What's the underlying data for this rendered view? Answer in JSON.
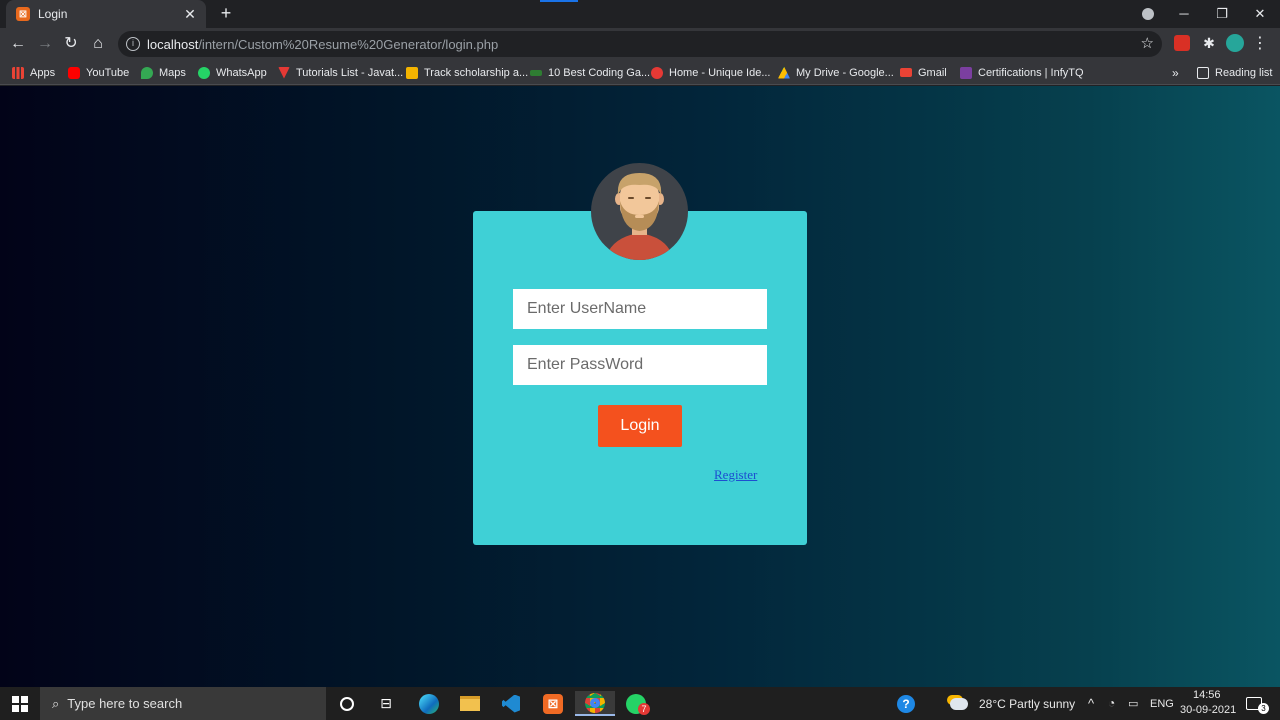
{
  "browser": {
    "tab_title": "Login",
    "tab_favicon": "xampp-icon",
    "url_host": "localhost",
    "url_path": "/intern/Custom%20Resume%20Generator/login.php",
    "bookmarks": [
      {
        "label": "Apps",
        "icon": "apps-grid-icon",
        "color": "#4285f4"
      },
      {
        "label": "YouTube",
        "icon": "youtube-icon",
        "color": "#ff0000"
      },
      {
        "label": "Maps",
        "icon": "maps-icon",
        "color": "#34a853"
      },
      {
        "label": "WhatsApp",
        "icon": "whatsapp-icon",
        "color": "#25d366"
      },
      {
        "label": "Tutorials List - Javat...",
        "icon": "javatpoint-icon",
        "color": "#e53935"
      },
      {
        "label": "Track scholarship a...",
        "icon": "scholarship-icon",
        "color": "#f4b400"
      },
      {
        "label": "10 Best Coding Ga...",
        "icon": "coding-games-icon",
        "color": "#2e7d32"
      },
      {
        "label": "Home - Unique Ide...",
        "icon": "rss-icon",
        "color": "#e53935"
      },
      {
        "label": "My Drive - Google...",
        "icon": "google-drive-icon",
        "color": "#fbbc04"
      },
      {
        "label": "Gmail",
        "icon": "gmail-icon",
        "color": "#ea4335"
      },
      {
        "label": "Certifications | InfyTQ",
        "icon": "infytq-icon",
        "color": "#7b3fa0"
      }
    ],
    "more_bookmarks": "»",
    "reading_list": "Reading list"
  },
  "login": {
    "username_placeholder": "Enter UserName",
    "password_placeholder": "Enter PassWord",
    "login_label": "Login",
    "register_label": "Register"
  },
  "taskbar": {
    "search_placeholder": "Type here to search",
    "weather": "28°C  Partly sunny",
    "language": "ENG",
    "time": "14:56",
    "date": "30-09-2021",
    "whatsapp_badge": "7",
    "notification_count": "3"
  },
  "colors": {
    "card": "#3fd0d6",
    "login_button": "#f4511e",
    "register_link": "#1d4fd0"
  }
}
